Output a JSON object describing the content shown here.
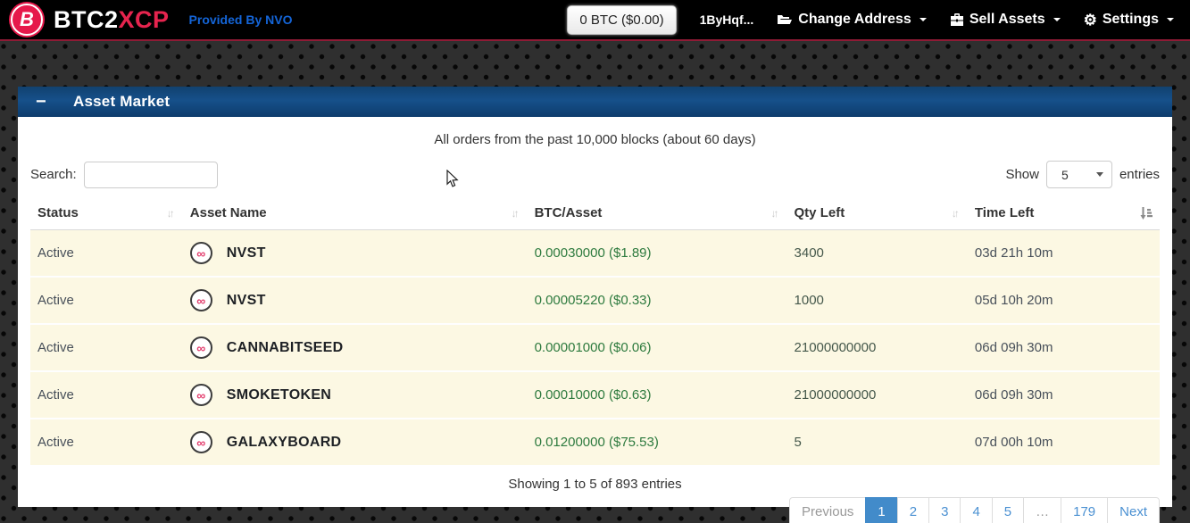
{
  "navbar": {
    "brand_btc2": "BTC2",
    "brand_xcp": "XCP",
    "logo_letter": "B",
    "tagline": "Provided By NVO",
    "balance_button": "0 BTC ($0.00)",
    "address": "1ByHqf...",
    "menu_change_address": "Change Address",
    "menu_sell_assets": "Sell Assets",
    "menu_settings": "Settings",
    "gear_glyph": "⚙"
  },
  "panel": {
    "collapse_icon": "−",
    "title": "Asset Market",
    "info": "All orders from the past 10,000 blocks (about 60 days)",
    "search_label": "Search:",
    "show_label": "Show",
    "entries_label": "entries",
    "page_size": "5",
    "table": {
      "columns": [
        "Status",
        "Asset Name",
        "BTC/Asset",
        "Qty Left",
        "Time Left"
      ],
      "sort_glyph": "↓↑",
      "infinity_glyph": "∞",
      "rows": [
        {
          "status": "Active",
          "asset": "NVST",
          "price": "0.00030000 ($1.89)",
          "qty": "3400",
          "time": "03d 21h 10m"
        },
        {
          "status": "Active",
          "asset": "NVST",
          "price": "0.00005220 ($0.33)",
          "qty": "1000",
          "time": "05d 10h 20m"
        },
        {
          "status": "Active",
          "asset": "CANNABITSEED",
          "price": "0.00001000 ($0.06)",
          "qty": "21000000000",
          "time": "06d 09h 30m"
        },
        {
          "status": "Active",
          "asset": "SMOKETOKEN",
          "price": "0.00010000 ($0.63)",
          "qty": "21000000000",
          "time": "06d 09h 30m"
        },
        {
          "status": "Active",
          "asset": "GALAXYBOARD",
          "price": "0.01200000 ($75.53)",
          "qty": "5",
          "time": "07d 00h 10m"
        }
      ]
    },
    "footer": {
      "summary": "Showing 1 to 5 of 893 entries",
      "pages": [
        "Previous",
        "1",
        "2",
        "3",
        "4",
        "5",
        "…",
        "179",
        "Next"
      ],
      "active_page": "1"
    }
  },
  "colors": {
    "accent_red": "#e6244e",
    "link_blue": "#428bca",
    "header_blue": "#16508a",
    "row_cream": "#fcf8e3",
    "price_green": "#2d7a3e",
    "nvo_blue": "#1465d8"
  }
}
